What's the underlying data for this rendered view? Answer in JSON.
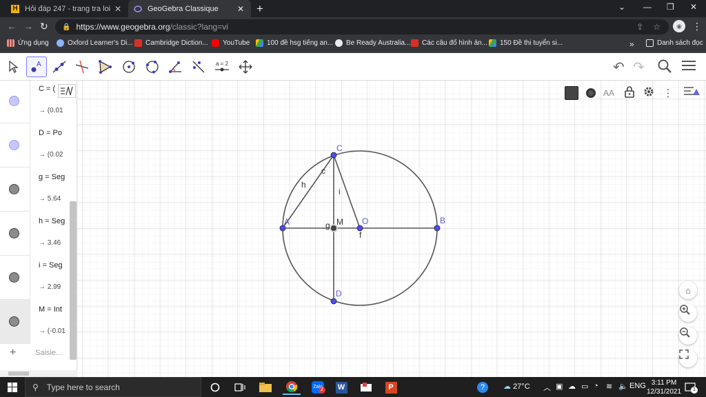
{
  "browser": {
    "tabs": [
      {
        "label": "Hỏi đáp 247 - trang tra loi",
        "favicon": "H"
      },
      {
        "label": "GeoGebra Classique",
        "favicon": "geogebra"
      }
    ],
    "url_host": "https://www.geogebra.org",
    "url_path": "/classic?lang=vi",
    "bookmarks": [
      "Ứng dụng",
      "Oxford Learner's Di...",
      "Cambridge Diction...",
      "YouTube",
      "100 đề hsg tiếng an...",
      "Be Ready Australia...",
      "Các câu đố hình ản...",
      "150 Đề thi tuyển si..."
    ],
    "reading_list": "Danh sách đọc",
    "more_bookmarks": "»"
  },
  "algebra": {
    "rows": [
      {
        "def": "C = (",
        "val": "→ (0.01",
        "color": "#c7c7ff"
      },
      {
        "def": "D = Po",
        "val": "→ (0.02",
        "color": "#c7c7ff"
      },
      {
        "def": "g = Seg",
        "val": "→ 5.64",
        "color": "#8c8c8c"
      },
      {
        "def": "h = Seg",
        "val": "→ 3.46",
        "color": "#8c8c8c"
      },
      {
        "def": "i = Seg",
        "val": "→ 2.99",
        "color": "#8c8c8c"
      },
      {
        "def": "M = Int",
        "val": "→ (-0.01",
        "color": "#8c8c8c"
      }
    ],
    "input_placeholder": "Saisie..."
  },
  "graphics_labels": {
    "A": "A",
    "B": "B",
    "C": "C",
    "D": "D",
    "O": "O",
    "M": "M",
    "c": "c",
    "f": "f",
    "g": "g",
    "h": "h",
    "i": "i"
  },
  "style_bar": {
    "font_size_label": "AA"
  },
  "taskbar": {
    "search_placeholder": "Type here to search",
    "weather": "27°C",
    "language": "ENG",
    "time": "3:11 PM",
    "date": "12/31/2021",
    "notifications": "1"
  }
}
